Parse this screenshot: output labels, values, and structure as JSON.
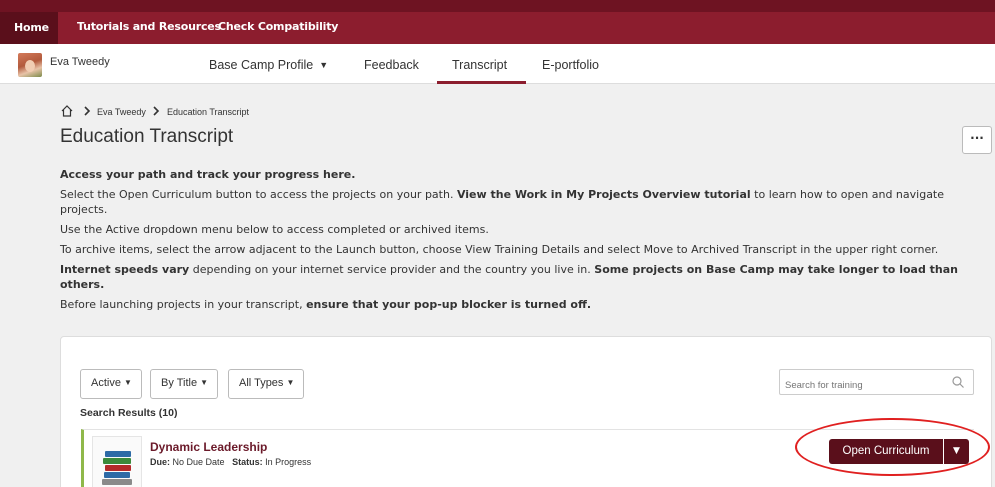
{
  "topnav": {
    "home": "Home",
    "tutorials": "Tutorials and Resources",
    "compat": "Check Compatibility"
  },
  "secnav": {
    "user_name": "Eva Tweedy",
    "tabs": [
      {
        "label": "Base Camp Profile",
        "caret": "▼"
      },
      {
        "label": "Feedback"
      },
      {
        "label": "Transcript"
      },
      {
        "label": "E-portfolio"
      }
    ],
    "active_tab": "Transcript"
  },
  "breadcrumb": {
    "items": [
      "Eva Tweedy",
      "Education Transcript"
    ]
  },
  "page": {
    "title": "Education Transcript",
    "more_label": "···"
  },
  "intro": {
    "heading": "Access your path and track your progress here.",
    "p1_a": "Select the Open Curriculum button to access the projects on your path. ",
    "p1_link": "View the Work in My Projects Overview tutorial",
    "p1_b": " to learn how to open and navigate projects.",
    "p2": "Use the Active dropdown menu below to access completed or archived items.",
    "p3": "To archive items, select the arrow adjacent to the Launch button, choose View Training Details and select Move to Archived Transcript in the upper right corner.",
    "p4_bold1": "Internet speeds vary",
    "p4_a": " depending on your internet service provider and the country you live in. ",
    "p4_bold2": "Some projects on Base Camp may take longer to load than others.",
    "p5_a": "Before launching projects in your transcript, ",
    "p5_bold": "ensure that your pop-up blocker is turned off."
  },
  "filters": {
    "status": "Active",
    "sort": "By Title",
    "type": "All Types",
    "caret": "▼"
  },
  "search": {
    "placeholder": "Search for training"
  },
  "results": {
    "label": "Search Results (10)"
  },
  "rows": [
    {
      "title": "Dynamic Leadership",
      "due_label": "Due:",
      "due_value": "No Due Date",
      "status_label": "Status:",
      "status_value": "In Progress",
      "action_label": "Open Curriculum",
      "caret": "▼"
    }
  ],
  "colors": {
    "brand": "#8c1d2e",
    "brand_dark": "#5a0f1b",
    "row_accent": "#8fb84a",
    "annotation": "#e02020"
  }
}
